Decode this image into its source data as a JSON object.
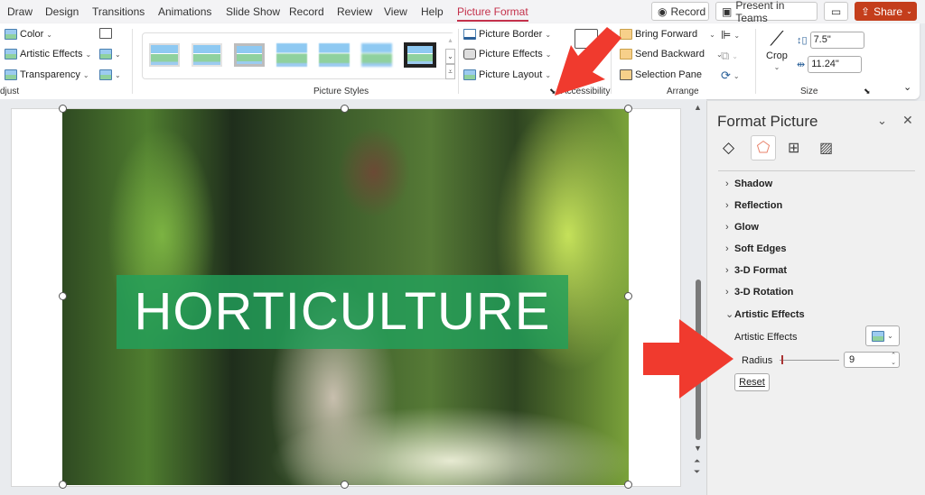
{
  "tabs": [
    "Draw",
    "Design",
    "Transitions",
    "Animations",
    "Slide Show",
    "Record",
    "Review",
    "View",
    "Help",
    "Picture Format"
  ],
  "active_tab": "Picture Format",
  "header_buttons": {
    "record": "Record",
    "present": "Present in Teams",
    "share": "Share"
  },
  "ribbon": {
    "adjust": {
      "label": "djust",
      "color": "Color",
      "artistic": "Artistic Effects",
      "transparency": "Transparency"
    },
    "styles": {
      "label": "Picture Styles",
      "count": 7
    },
    "picture": {
      "border": "Picture Border",
      "effects": "Picture Effects",
      "layout": "Picture Layout"
    },
    "accessibility": {
      "label": "Accessibility"
    },
    "arrange": {
      "label": "Arrange",
      "bring": "Bring Forward",
      "send": "Send Backward",
      "selection": "Selection Pane"
    },
    "size": {
      "label": "Size",
      "crop": "Crop",
      "height": "7.5\"",
      "width": "11.24\""
    }
  },
  "slide": {
    "banner_text": "HORTICULTURE"
  },
  "pane": {
    "title": "Format Picture",
    "sections": [
      "Shadow",
      "Reflection",
      "Glow",
      "Soft Edges",
      "3-D Format",
      "3-D Rotation",
      "Artistic Effects"
    ],
    "artistic_label": "Artistic Effects",
    "radius_label": "Radius",
    "radius_value": "9",
    "reset": "Reset"
  }
}
